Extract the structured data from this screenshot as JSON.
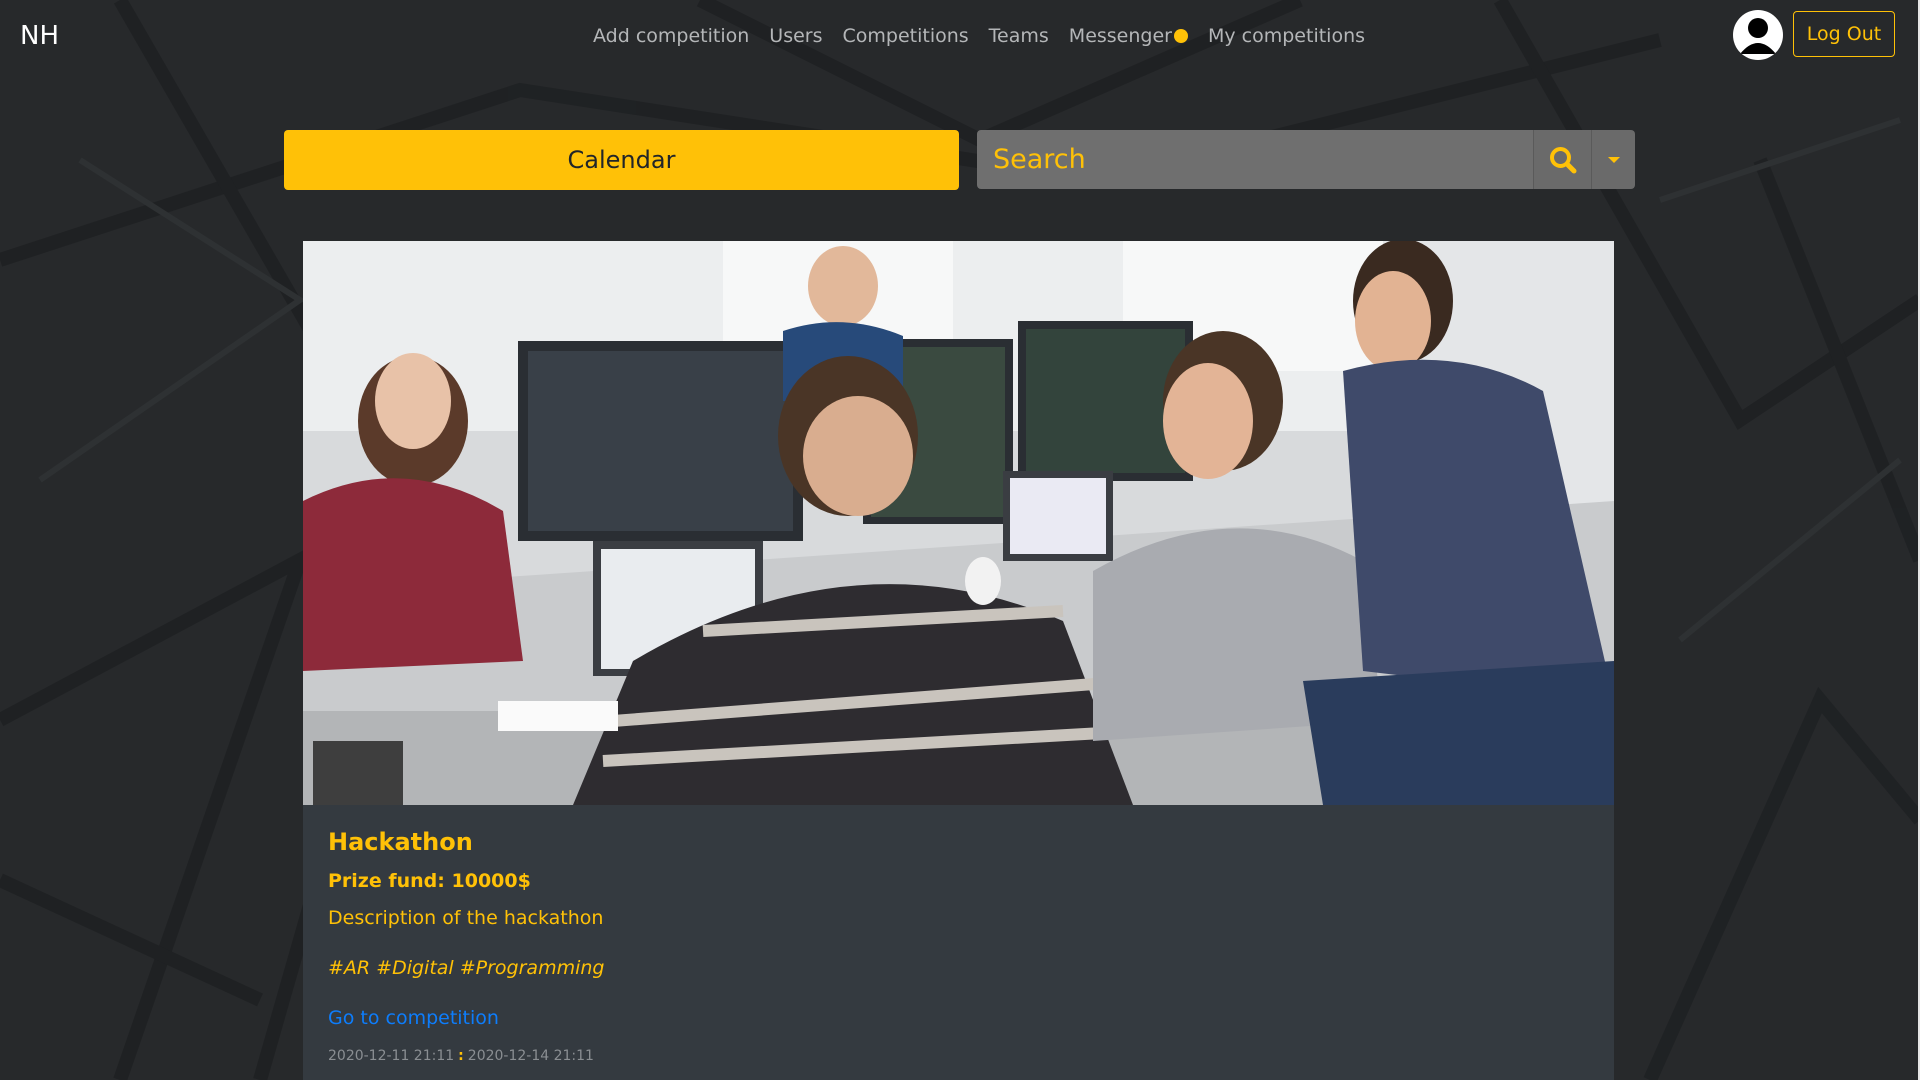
{
  "nav": {
    "brand": "NH",
    "links": [
      "Add competition",
      "Users",
      "Competitions",
      "Teams",
      "Messenger",
      "My competitions"
    ],
    "logout_label": "Log Out",
    "accent_color": "#ffc107"
  },
  "toolbar": {
    "calendar_label": "Calendar",
    "search_placeholder": "Search"
  },
  "card": {
    "title": "Hackathon",
    "prize": "Prize fund: 10000$",
    "description": "Description of the hackathon",
    "tags": "#AR #Digital #Programming",
    "link_label": "Go to competition",
    "start": "2020-12-11 21:11",
    "separator": ":",
    "end": "2020-12-14 21:11"
  }
}
